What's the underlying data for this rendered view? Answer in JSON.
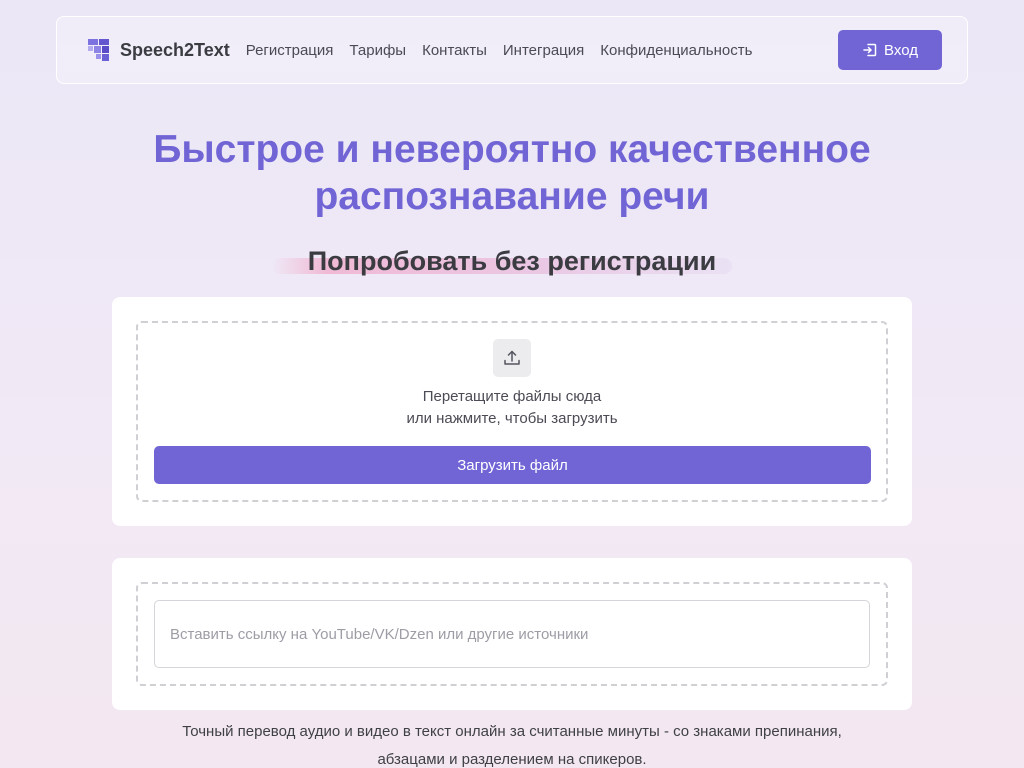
{
  "header": {
    "brand": "Speech2Text",
    "nav": [
      "Регистрация",
      "Тарифы",
      "Контакты",
      "Интеграция",
      "Конфиденциальность"
    ],
    "login_label": "Вход",
    "logo_icon": "grid-logo-icon",
    "login_icon": "login-icon"
  },
  "hero": {
    "title_line1": "Быстрое и невероятно качественное",
    "title_line2": "распознавание речи",
    "subtitle": "Попробовать без регистрации"
  },
  "upload": {
    "icon": "upload-icon",
    "drop_line1": "Перетащите файлы сюда",
    "drop_line2": "или нажмите, чтобы загрузить",
    "button_label": "Загрузить файл"
  },
  "link": {
    "placeholder": "Вставить ссылку на YouTube/VK/Dzen или другие источники",
    "value": ""
  },
  "description": {
    "line1": "Точный перевод аудио и видео в текст онлайн за считанные минуты - со знаками препинания,",
    "line2": "абзацами и разделением на спикеров."
  },
  "colors": {
    "accent": "#7165d6",
    "heading": "#3b3b42"
  }
}
